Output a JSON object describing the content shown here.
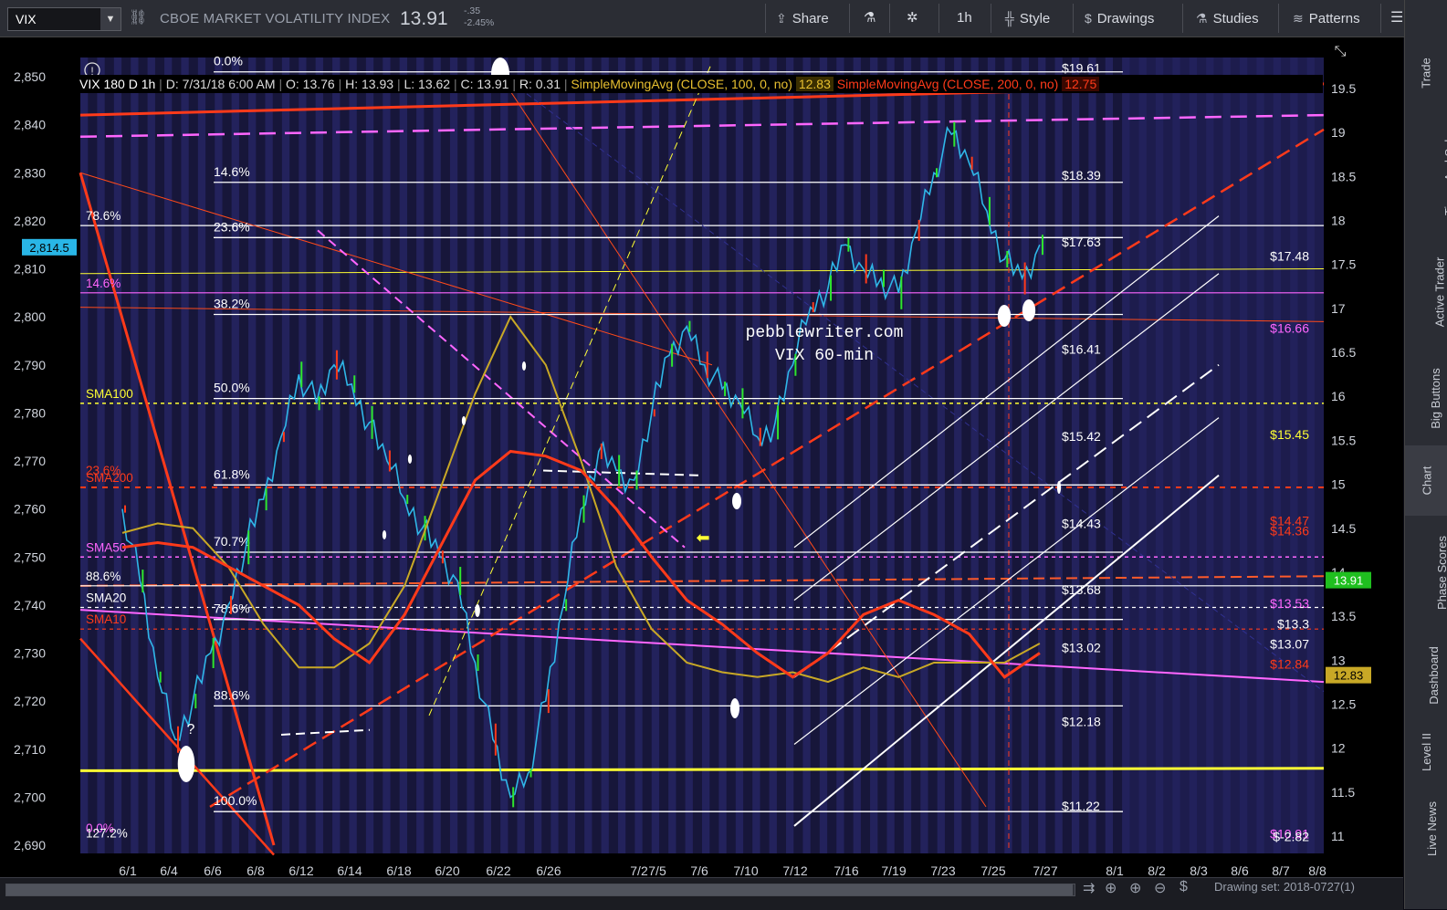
{
  "toolbar": {
    "symbol": "VIX",
    "title": "CBOE MARKET VOLATILITY INDEX",
    "last": "13.91",
    "change": "-.35",
    "change_pct": "-2.45%",
    "share": "Share",
    "timeframe": "1h",
    "style": "Style",
    "drawings": "Drawings",
    "studies": "Studies",
    "patterns": "Patterns"
  },
  "info": {
    "period": "VIX 180 D 1h",
    "date": "D: 7/31/18 6:00 AM",
    "open": "O: 13.76",
    "high": "H: 13.93",
    "low": "L: 13.62",
    "close": "C: 13.91",
    "range": "R: 0.31",
    "sma100_label": "SimpleMovingAvg (CLOSE, 100, 0, no)",
    "sma100_value": "12.83",
    "sma200_label": "SimpleMovingAvg (CLOSE, 200, 0, no)",
    "sma200_value": "12.75"
  },
  "watermark": {
    "line1": "pebblewriter.com",
    "line2": "VIX 60-min"
  },
  "colors": {
    "background": "#17163a",
    "vix_line": "#2fb7e8",
    "sma100": "#c8a826",
    "sma200": "#ff3a1a",
    "fib": "#ffffff",
    "magenta": "#ff66ff",
    "yellow": "#ffff33",
    "red_line": "#ff3a1a"
  },
  "chart_data": {
    "type": "line",
    "left_axis_label": "SPX",
    "left_ticks": [
      2850,
      2840,
      2830,
      2820,
      2810,
      2800,
      2790,
      2780,
      2770,
      2760,
      2750,
      2740,
      2730,
      2720,
      2710,
      2700,
      2690
    ],
    "right_ticks": [
      19.5,
      19,
      18.5,
      18,
      17.5,
      17,
      16.5,
      16,
      15.5,
      15,
      14.5,
      14,
      13.5,
      13,
      12.5,
      12,
      11.5,
      11
    ],
    "x_ticks": [
      "6/1",
      "6/4",
      "6/6",
      "6/8",
      "6/12",
      "6/14",
      "6/18",
      "6/20",
      "6/22",
      "6/26",
      "7/2",
      "7/5",
      "7/6",
      "7/10",
      "7/12",
      "7/16",
      "7/19",
      "7/23",
      "7/25",
      "7/27",
      "8/1",
      "8/2",
      "8/3",
      "8/6",
      "8/7",
      "8/8"
    ],
    "spx_current": "2,814.5",
    "vix_current": "13.91",
    "sma100_current": "12.83",
    "fib_spx": [
      {
        "label": "0.0%",
        "value": 2851
      },
      {
        "label": "14.6%",
        "value": 2828
      },
      {
        "label": "23.6%",
        "value": 2816.5
      },
      {
        "label": "38.2%",
        "value": 2800.5
      },
      {
        "label": "50.0%",
        "value": 2783
      },
      {
        "label": "61.8%",
        "value": 2765
      },
      {
        "label": "70.7%",
        "value": 2751
      },
      {
        "label": "78.6%",
        "value": 2737
      },
      {
        "label": "88.6%",
        "value": 2719
      },
      {
        "label": "100.0%",
        "value": 2697
      }
    ],
    "fib_vix": [
      {
        "label": "$19.61",
        "value": 19.61
      },
      {
        "label": "$18.39",
        "value": 18.39
      },
      {
        "label": "$17.63",
        "value": 17.63
      },
      {
        "label": "$16.41",
        "value": 16.41
      },
      {
        "label": "$15.42",
        "value": 15.42
      },
      {
        "label": "$14.43",
        "value": 14.43
      },
      {
        "label": "$13.68",
        "value": 13.68
      },
      {
        "label": "$13.02",
        "value": 13.02
      },
      {
        "label": "$12.18",
        "value": 12.18
      },
      {
        "label": "$11.22",
        "value": 11.22
      }
    ],
    "right_levels": [
      {
        "label": "$17.48",
        "value": 17.48,
        "color": "#ffffff"
      },
      {
        "label": "$16.66",
        "value": 16.66,
        "color": "#ff66ff"
      },
      {
        "label": "$15.45",
        "value": 15.45,
        "color": "#ffff33"
      },
      {
        "label": "$14.47",
        "value": 14.47,
        "color": "#ff3a1a"
      },
      {
        "label": "$14.36",
        "value": 14.36,
        "color": "#ff3a1a"
      },
      {
        "label": "$13.53",
        "value": 13.53,
        "color": "#ff66ff"
      },
      {
        "label": "$13.3",
        "value": 13.3,
        "color": "#ffffff"
      },
      {
        "label": "$13.07",
        "value": 13.07,
        "color": "#ffffff"
      },
      {
        "label": "$12.84",
        "value": 12.84,
        "color": "#ff3a1a"
      },
      {
        "label": "$10.91",
        "value": 10.91,
        "color": "#ff66ff"
      },
      {
        "label": "$-2.82",
        "value": 10.88,
        "color": "#ffffff"
      }
    ],
    "left_levels": [
      {
        "label": "78.6%",
        "value": 2819,
        "color": "#ffffff"
      },
      {
        "label": "14.6%",
        "value": 2805,
        "color": "#ff66ff"
      },
      {
        "label": "SMA100",
        "value": 2782,
        "color": "#ffff33"
      },
      {
        "label": "23.6%",
        "value": 2766,
        "color": "#ff3a1a"
      },
      {
        "label": "SMA200",
        "value": 2764.5,
        "color": "#ff3a1a"
      },
      {
        "label": "SMA50",
        "value": 2750,
        "color": "#ff66ff"
      },
      {
        "label": "88.6%",
        "value": 2744,
        "color": "#ffffff"
      },
      {
        "label": "SMA20",
        "value": 2739.5,
        "color": "#ffffff"
      },
      {
        "label": "SMA10",
        "value": 2735,
        "color": "#ff3a1a"
      },
      {
        "label": "0.0%",
        "value": 2691.5,
        "color": "#ff66ff"
      },
      {
        "label": "127.2%",
        "value": 2690.5,
        "color": "#ffffff"
      }
    ],
    "vix_series": [
      [
        0,
        2760
      ],
      [
        2,
        2745
      ],
      [
        4,
        2725
      ],
      [
        6,
        2712
      ],
      [
        8,
        2720
      ],
      [
        10,
        2730
      ],
      [
        12,
        2740
      ],
      [
        14,
        2752
      ],
      [
        16,
        2762
      ],
      [
        18,
        2775
      ],
      [
        20,
        2788
      ],
      [
        22,
        2782
      ],
      [
        24,
        2790
      ],
      [
        26,
        2786
      ],
      [
        28,
        2778
      ],
      [
        30,
        2770
      ],
      [
        32,
        2762
      ],
      [
        34,
        2756
      ],
      [
        36,
        2750
      ],
      [
        38,
        2745
      ],
      [
        40,
        2728
      ],
      [
        42,
        2712
      ],
      [
        44,
        2700
      ],
      [
        46,
        2705
      ],
      [
        48,
        2720
      ],
      [
        50,
        2740
      ],
      [
        52,
        2760
      ],
      [
        54,
        2772
      ],
      [
        56,
        2768
      ],
      [
        58,
        2766
      ],
      [
        60,
        2780
      ],
      [
        62,
        2792
      ],
      [
        64,
        2798
      ],
      [
        66,
        2790
      ],
      [
        68,
        2785
      ],
      [
        70,
        2782
      ],
      [
        72,
        2775
      ],
      [
        74,
        2778
      ],
      [
        76,
        2790
      ],
      [
        78,
        2802
      ],
      [
        80,
        2806
      ],
      [
        82,
        2815
      ],
      [
        84,
        2810
      ],
      [
        86,
        2808
      ],
      [
        88,
        2805
      ],
      [
        90,
        2818
      ],
      [
        92,
        2830
      ],
      [
        94,
        2838
      ],
      [
        96,
        2832
      ],
      [
        98,
        2822
      ],
      [
        100,
        2812
      ],
      [
        102,
        2808
      ],
      [
        104,
        2815
      ]
    ],
    "sma100_series": [
      [
        0,
        2755
      ],
      [
        4,
        2757
      ],
      [
        8,
        2756
      ],
      [
        12,
        2748
      ],
      [
        16,
        2736
      ],
      [
        20,
        2727
      ],
      [
        24,
        2727
      ],
      [
        28,
        2732
      ],
      [
        32,
        2744
      ],
      [
        36,
        2764
      ],
      [
        40,
        2784
      ],
      [
        44,
        2800
      ],
      [
        48,
        2790
      ],
      [
        52,
        2770
      ],
      [
        56,
        2748
      ],
      [
        60,
        2735
      ],
      [
        64,
        2728
      ],
      [
        68,
        2726
      ],
      [
        72,
        2725
      ],
      [
        76,
        2726
      ],
      [
        80,
        2724
      ],
      [
        84,
        2727
      ],
      [
        88,
        2725
      ],
      [
        92,
        2728
      ],
      [
        96,
        2728
      ],
      [
        100,
        2728
      ],
      [
        104,
        2732
      ]
    ],
    "sma200_series": [
      [
        0,
        2752
      ],
      [
        4,
        2753
      ],
      [
        8,
        2752
      ],
      [
        12,
        2748
      ],
      [
        16,
        2744
      ],
      [
        20,
        2740
      ],
      [
        24,
        2733
      ],
      [
        28,
        2728
      ],
      [
        32,
        2738
      ],
      [
        36,
        2752
      ],
      [
        40,
        2766
      ],
      [
        44,
        2772
      ],
      [
        48,
        2771
      ],
      [
        52,
        2768
      ],
      [
        56,
        2760
      ],
      [
        60,
        2750
      ],
      [
        64,
        2741
      ],
      [
        68,
        2736
      ],
      [
        72,
        2730
      ],
      [
        76,
        2725
      ],
      [
        80,
        2730
      ],
      [
        84,
        2738
      ],
      [
        88,
        2741
      ],
      [
        92,
        2738
      ],
      [
        96,
        2734
      ],
      [
        100,
        2725
      ],
      [
        104,
        2730
      ]
    ]
  },
  "rightbar": [
    "Trade",
    "Times And Sales",
    "Active Trader",
    "Big Buttons",
    "Chart",
    "Phase Scores",
    "Dashboard",
    "Level II",
    "Live News"
  ],
  "footer": {
    "drawing_set": "Drawing set: 2018-0727(1)"
  }
}
